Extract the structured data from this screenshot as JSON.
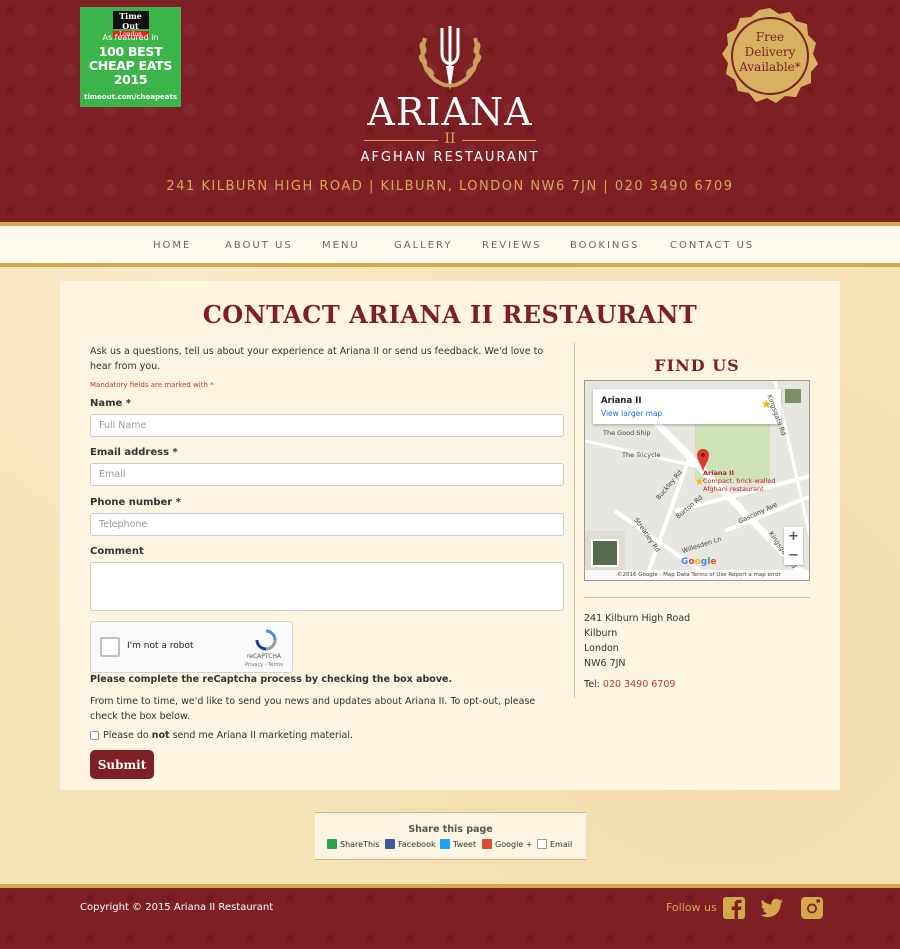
{
  "header": {
    "timeout": {
      "logo_top": "Time Out",
      "logo_city": "London",
      "featured": "As featured in",
      "headline": "100 BEST CHEAP EATS 2015",
      "url": "timeout.com/cheapeats"
    },
    "brand": "ARIANA",
    "brand_number": "II",
    "brand_sub": "AFGHAN RESTAURANT",
    "address": "241 KILBURN HIGH ROAD | KILBURN, LONDON NW6 7JN | 020 3490 6709",
    "badge": {
      "line1": "Free",
      "line2": "Delivery",
      "line3": "Available*"
    }
  },
  "nav": {
    "items": [
      {
        "label": "HOME"
      },
      {
        "label": "ABOUT US"
      },
      {
        "label": "MENU"
      },
      {
        "label": "GALLERY"
      },
      {
        "label": "REVIEWS"
      },
      {
        "label": "BOOKINGS"
      },
      {
        "label": "CONTACT US"
      }
    ]
  },
  "page": {
    "title": "CONTACT ARIANA II RESTAURANT",
    "intro": "Ask us a questions, tell us about your experience at Ariana II or send us feedback. We'd love to hear from you.",
    "mandatory": "Mandatory fields are marked with *"
  },
  "form": {
    "name_label": "Name *",
    "name_placeholder": "Full Name",
    "email_label": "Email address *",
    "email_placeholder": "Email",
    "phone_label": "Phone number *",
    "phone_placeholder": "Telephone",
    "comment_label": "Comment",
    "comment_placeholder": "",
    "captcha_label": "I'm not a robot",
    "captcha_brand": "reCAPTCHA",
    "captcha_terms": "Privacy - Terms",
    "captcha_warning": "Please complete the reCaptcha process by checking the box above.",
    "optout_text": "From time to time, we'd like to send you news and updates about Ariana II. To opt-out, please check the box below.",
    "optout_prefix": "Please do ",
    "optout_bold": "not",
    "optout_suffix": " send me Ariana II marketing material.",
    "submit_label": "Submit"
  },
  "find_us": {
    "title": "FIND US",
    "map": {
      "place_name": "Ariana II",
      "larger_map": "View larger map",
      "pin_name": "Ariana II",
      "pin_desc1": "Compact, brick-walled",
      "pin_desc2": "Afghani restaurant",
      "labels": [
        "The Good Ship",
        "The Tricycle",
        "Buckley Rd",
        "Burton Rd",
        "Streatley Rd",
        "Willesden Ln",
        "Gascony Ave",
        "Kingsgate Rd",
        "Kingsgate Rd"
      ],
      "google": "Google",
      "footer": "©2016 Google - Map Data   Terms of Use   Report a map error"
    },
    "address_lines": [
      "241 Kilburn High Road",
      "Kilburn",
      "London",
      "NW6 7JN"
    ],
    "tel_label": "Tel: ",
    "tel_number": "020 3490 6709"
  },
  "share": {
    "title": "Share this page",
    "items": [
      {
        "label": "ShareThis",
        "icon": "sharethis-icon",
        "color": "#2ea44f"
      },
      {
        "label": "Facebook",
        "icon": "facebook-icon",
        "color": "#3b5998"
      },
      {
        "label": "Tweet",
        "icon": "twitter-icon",
        "color": "#1da1f2"
      },
      {
        "label": "Google +",
        "icon": "googleplus-icon",
        "color": "#dd4b39"
      },
      {
        "label": "Email",
        "icon": "email-icon",
        "color": "#999999"
      }
    ]
  },
  "footer": {
    "copyright": "Copyright © 2015 Ariana II Restaurant",
    "follow": "Follow us",
    "social": [
      "facebook-icon",
      "twitter-icon",
      "instagram-icon"
    ]
  },
  "colors": {
    "brand": "#7e1f23",
    "gold": "#d4a94c",
    "cream": "#fdf4e2"
  }
}
